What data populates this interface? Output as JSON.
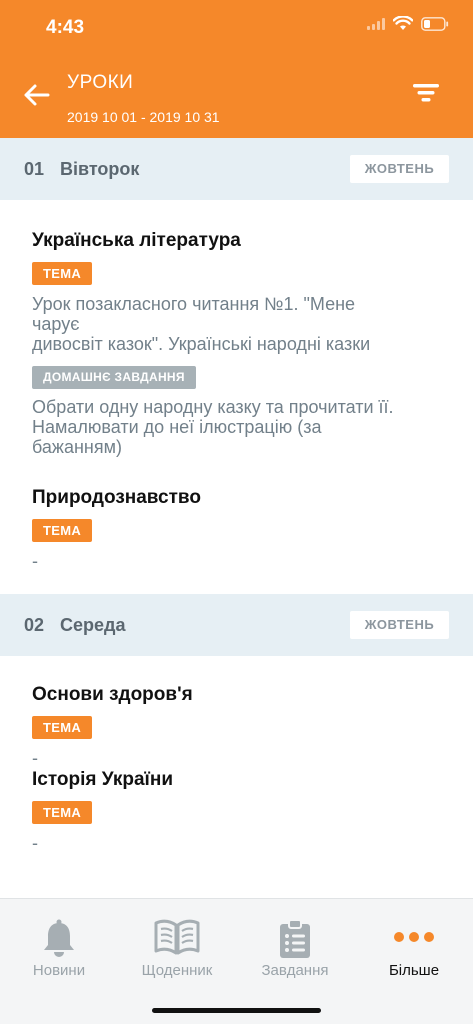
{
  "status": {
    "time": "4:43"
  },
  "header": {
    "title": "УРОКИ",
    "date_range": "2019 10 01 - 2019 10 31"
  },
  "days": [
    {
      "num": "01",
      "name": "Вівторок",
      "month": "ЖОВТЕНЬ",
      "lessons": [
        {
          "subject": "Українська література",
          "topic_label": "ТЕМА",
          "topic_lines": [
            "Урок позакласного читання №1. \"Мене",
            "чарує",
            "дивосвіт казок\". Українські народні казки"
          ],
          "hw_label": "ДОМАШНЄ ЗАВДАННЯ",
          "hw_lines": [
            "Обрати одну народну казку та прочитати її.",
            "Намалювати до неї ілюстрацію (за",
            "бажанням)"
          ]
        },
        {
          "subject": "Природознавство",
          "topic_label": "ТЕМА",
          "topic_text": "-"
        }
      ]
    },
    {
      "num": "02",
      "name": "Середа",
      "month": "ЖОВТЕНЬ",
      "lessons": [
        {
          "subject": "Основи здоров'я",
          "topic_label": "ТЕМА",
          "topic_text": "-"
        },
        {
          "subject": "Історія України",
          "topic_label": "ТЕМА",
          "topic_text": "-"
        }
      ]
    }
  ],
  "tabbar": {
    "accent": "#f5882a",
    "items": [
      {
        "label": "Новини",
        "icon": "bell-icon"
      },
      {
        "label": "Щоденник",
        "icon": "book-icon"
      },
      {
        "label": "Завдання",
        "icon": "clipboard-icon"
      },
      {
        "label": "Більше",
        "icon": "more-dots-icon",
        "active": true
      }
    ]
  }
}
